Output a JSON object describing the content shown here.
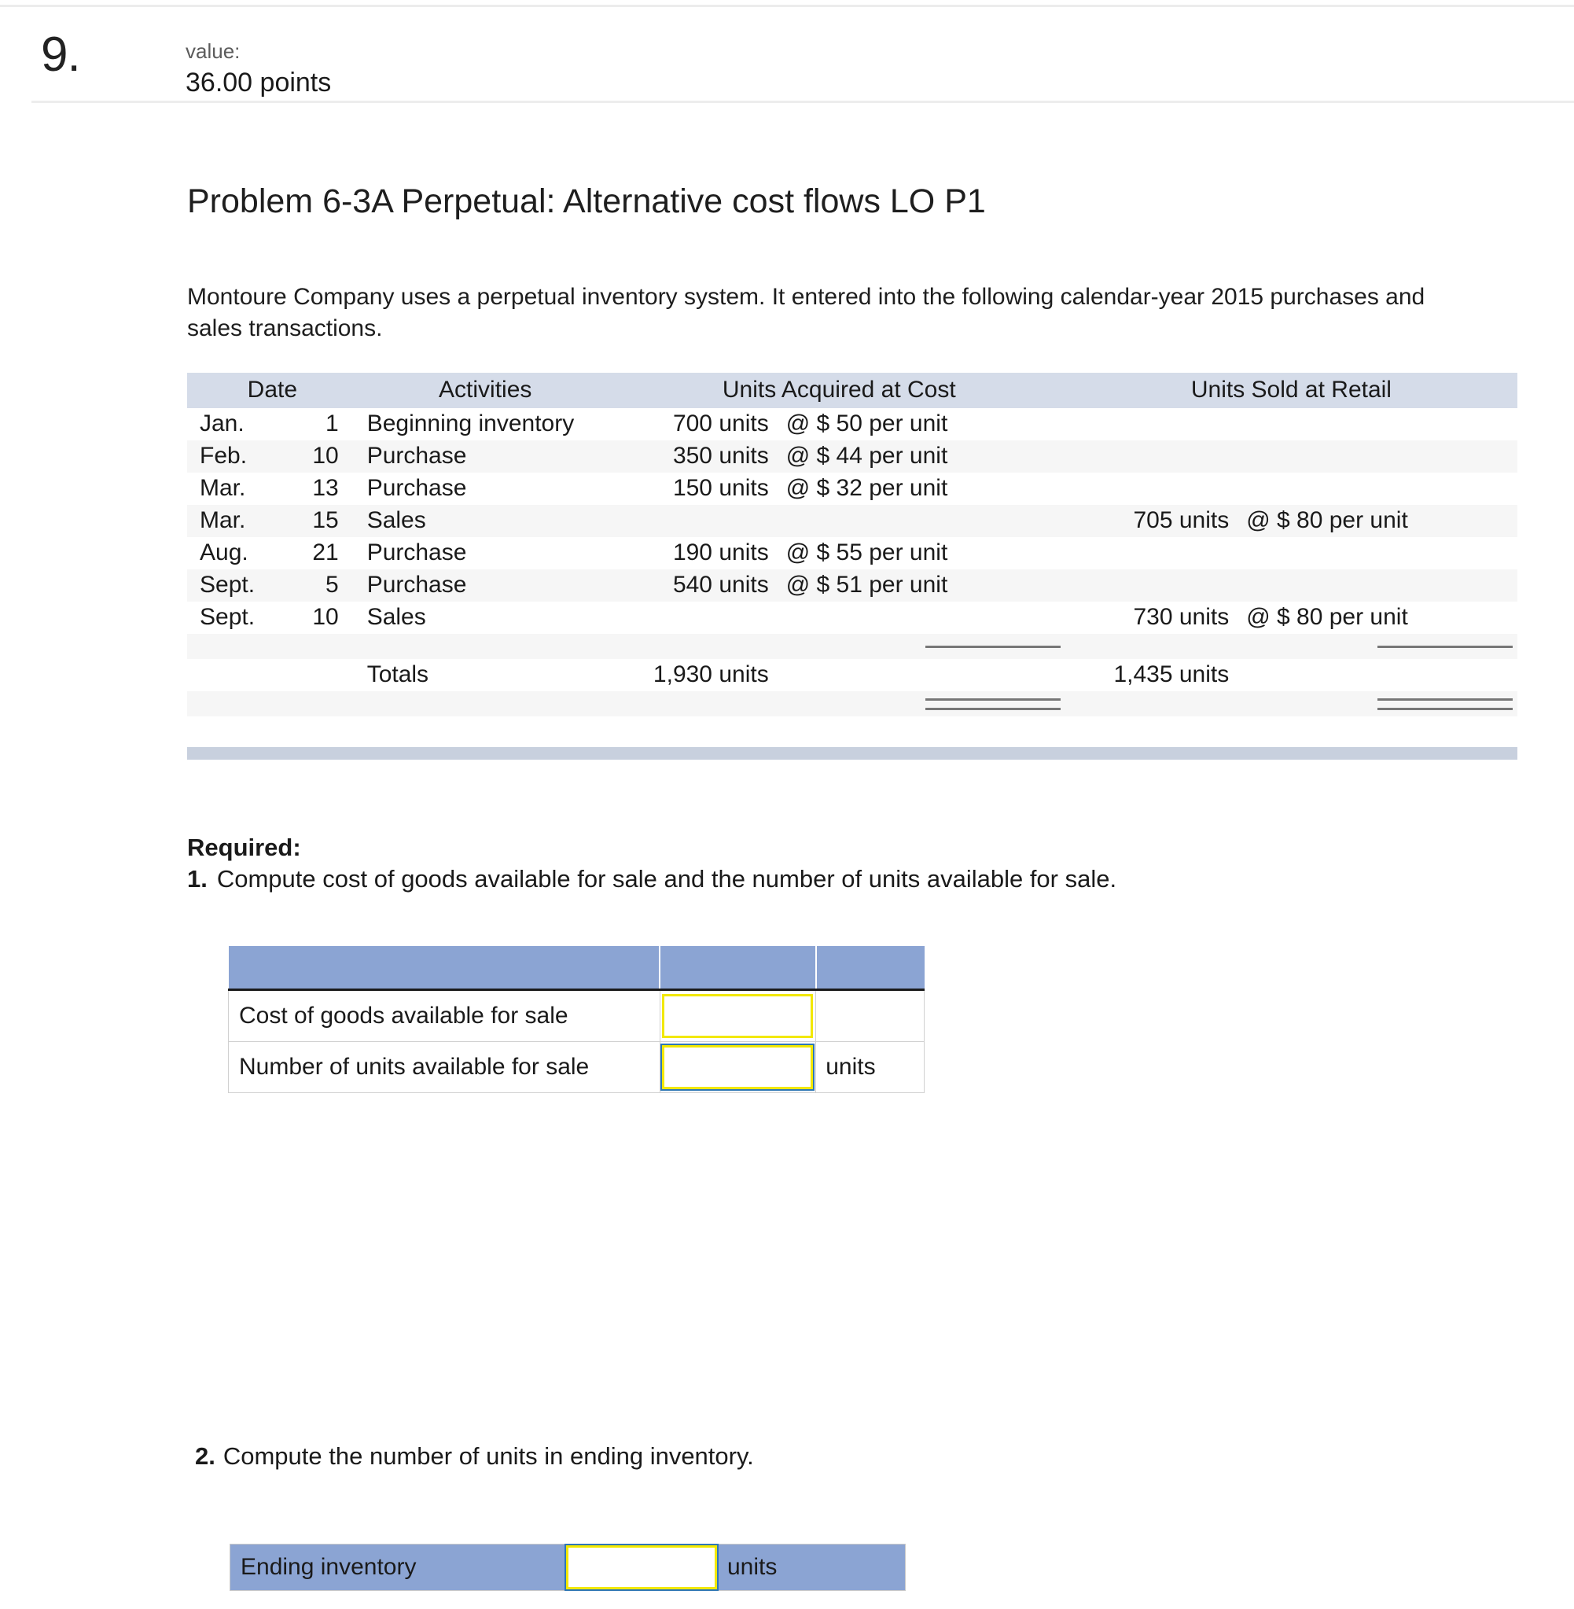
{
  "question": {
    "number": "9.",
    "value_label": "value:",
    "points": "36.00 points"
  },
  "problem": {
    "title": "Problem 6-3A Perpetual: Alternative cost flows LO P1",
    "intro": "Montoure Company uses a perpetual inventory system. It entered into the following calendar-year 2015 purchases and sales transactions."
  },
  "transactions_table": {
    "headers": {
      "date": "Date",
      "activities": "Activities",
      "acquired": "Units Acquired at Cost",
      "sold": "Units Sold at Retail"
    },
    "rows": [
      {
        "month": "Jan.",
        "day": "1",
        "activity": "Beginning inventory",
        "aq_units": "700 units",
        "aq_rate": "@ $ 50 per unit",
        "sold_units": "",
        "sold_rate": ""
      },
      {
        "month": "Feb.",
        "day": "10",
        "activity": "Purchase",
        "aq_units": "350 units",
        "aq_rate": "@ $ 44 per unit",
        "sold_units": "",
        "sold_rate": ""
      },
      {
        "month": "Mar.",
        "day": "13",
        "activity": "Purchase",
        "aq_units": "150 units",
        "aq_rate": "@ $ 32 per unit",
        "sold_units": "",
        "sold_rate": ""
      },
      {
        "month": "Mar.",
        "day": "15",
        "activity": "Sales",
        "aq_units": "",
        "aq_rate": "",
        "sold_units": "705 units",
        "sold_rate": "@ $ 80 per unit"
      },
      {
        "month": "Aug.",
        "day": "21",
        "activity": "Purchase",
        "aq_units": "190 units",
        "aq_rate": "@ $ 55 per unit",
        "sold_units": "",
        "sold_rate": ""
      },
      {
        "month": "Sept.",
        "day": "5",
        "activity": "Purchase",
        "aq_units": "540 units",
        "aq_rate": "@ $ 51 per unit",
        "sold_units": "",
        "sold_rate": ""
      },
      {
        "month": "Sept.",
        "day": "10",
        "activity": "Sales",
        "aq_units": "",
        "aq_rate": "",
        "sold_units": "730 units",
        "sold_rate": "@ $ 80 per unit"
      }
    ],
    "totals": {
      "label": "Totals",
      "acquired_total": "1,930 units",
      "sold_total": "1,435 units"
    }
  },
  "required": {
    "label": "Required:",
    "item1_number": "1.",
    "item1_text": "Compute cost of goods available for sale and the number of units available for sale.",
    "item2_number": "2.",
    "item2_text": "Compute the number of units in ending inventory."
  },
  "answer_table_1": {
    "rows": [
      {
        "label": "Cost of goods available for sale",
        "value": "",
        "unit": ""
      },
      {
        "label": "Number of units available for sale",
        "value": "",
        "unit": "units"
      }
    ]
  },
  "answer_table_2": {
    "label": "Ending inventory",
    "value": "",
    "unit": "units"
  },
  "colors": {
    "table_header": "#d5dce9",
    "answer_header": "#8ba4d3",
    "divider": "#c8d0de",
    "input_border": "#f2e800",
    "focus_ring": "#2f77b5"
  }
}
